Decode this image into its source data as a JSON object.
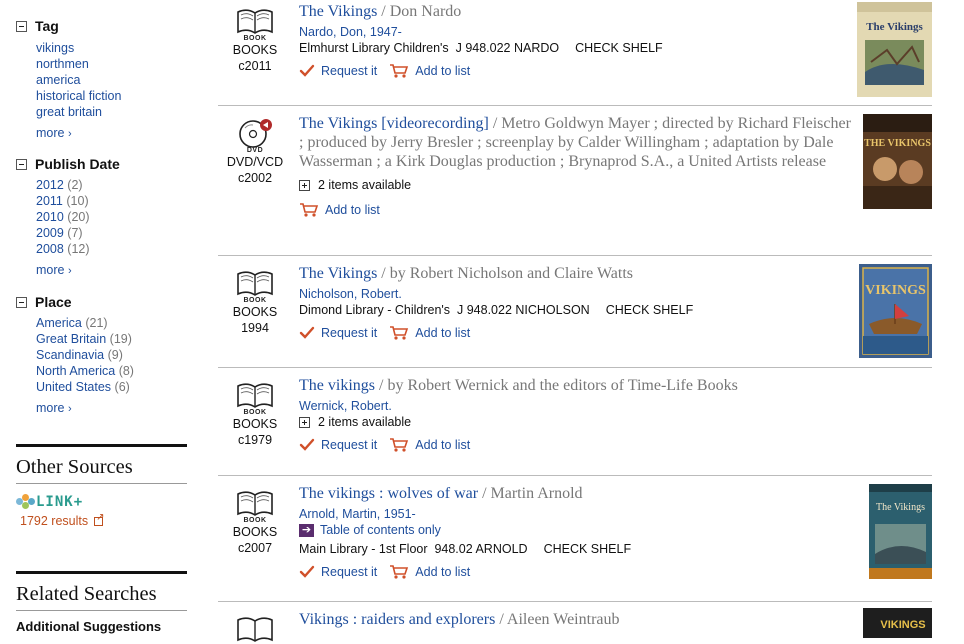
{
  "sidebar": {
    "tag": {
      "title": "Tag",
      "items": [
        "vikings",
        "northmen",
        "america",
        "historical fiction",
        "great britain"
      ],
      "more": "more"
    },
    "publish_date": {
      "title": "Publish Date",
      "items": [
        {
          "label": "2012",
          "count": "(2)"
        },
        {
          "label": "2011",
          "count": "(10)"
        },
        {
          "label": "2010",
          "count": "(20)"
        },
        {
          "label": "2009",
          "count": "(7)"
        },
        {
          "label": "2008",
          "count": "(12)"
        }
      ],
      "more": "more"
    },
    "place": {
      "title": "Place",
      "items": [
        {
          "label": "America",
          "count": "(21)"
        },
        {
          "label": "Great Britain",
          "count": "(19)"
        },
        {
          "label": "Scandinavia",
          "count": "(9)"
        },
        {
          "label": "North America",
          "count": "(8)"
        },
        {
          "label": "United States",
          "count": "(6)"
        }
      ],
      "more": "more"
    },
    "other_sources": {
      "title": "Other Sources",
      "linkplus_label": "LINK+",
      "results": "1792 results"
    },
    "related_searches": {
      "title": "Related Searches",
      "additional": "Additional Suggestions"
    }
  },
  "results": [
    {
      "format_small": "BOOK",
      "format_label": "BOOKS",
      "year": "c2011",
      "title": "The Vikings",
      "responsibility": " / Don Nardo",
      "author": "Nardo, Don, 1947-",
      "holding_location": "Elmhurst Library Children's  J 948.022 NARDO",
      "holding_status": "CHECK SHELF",
      "request": "Request it",
      "add": "Add to list",
      "cover_title": "The Vikings"
    },
    {
      "format_small": "DVD",
      "format_label": "DVD/VCD",
      "year": "c2002",
      "title": "The Vikings [videorecording]",
      "responsibility": " / Metro Goldwyn Mayer ; directed by Richard Fleischer ; produced by Jerry Bresler ; screenplay by Calder Willingham ; adaptation by Dale Wasserman ; a Kirk Douglas production ; Brynaprod S.A., a United Artists release",
      "availability": "2 items available",
      "add": "Add to list",
      "cover_title": "THE VIKINGS"
    },
    {
      "format_small": "BOOK",
      "format_label": "BOOKS",
      "year": "1994",
      "title": "The Vikings",
      "responsibility": " / by Robert Nicholson and Claire Watts",
      "author": "Nicholson, Robert.",
      "holding_location": "Dimond Library - Children's  J 948.022 NICHOLSON",
      "holding_status": "CHECK SHELF",
      "request": "Request it",
      "add": "Add to list",
      "cover_title": "VIKINGS"
    },
    {
      "format_small": "BOOK",
      "format_label": "BOOKS",
      "year": "c1979",
      "title": "The vikings",
      "responsibility": " / by Robert Wernick and the editors of Time-Life Books",
      "author": "Wernick, Robert.",
      "availability": "2 items available",
      "request": "Request it",
      "add": "Add to list"
    },
    {
      "format_small": "BOOK",
      "format_label": "BOOKS",
      "year": "c2007",
      "title": "The vikings : wolves of war",
      "responsibility": " / Martin Arnold",
      "author": "Arnold, Martin, 1951-",
      "toc": "Table of contents only",
      "holding_location": "Main Library - 1st Floor  948.02 ARNOLD",
      "holding_status": "CHECK SHELF",
      "request": "Request it",
      "add": "Add to list",
      "cover_title": "The Vikings"
    },
    {
      "title": "Vikings : raiders and explorers",
      "responsibility": " / Aileen Weintraub",
      "cover_title": "VIKINGS"
    }
  ],
  "colors": {
    "link": "#1f4e9c",
    "muted": "#777777",
    "orange": "#c0501e",
    "linkplus": "#2a9b8e",
    "check": "#d0502a"
  }
}
